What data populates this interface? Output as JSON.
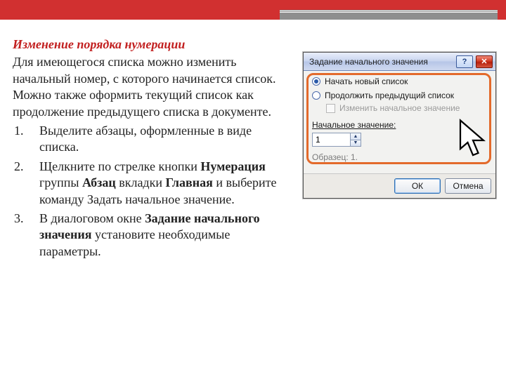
{
  "slide": {
    "title": "Изменение порядка нумерации",
    "paragraph": "Для имеющегося списка можно изменить начальный номер, с которого начинается список. Можно также оформить текущий список как продолжение предыдущего списка в документе.",
    "steps": [
      {
        "text": "Выделите абзацы, оформленные в виде списка."
      },
      {
        "prefix": "Щелкните по стрелке кнопки ",
        "b1": "Нумерация",
        "mid1": " группы ",
        "b2": "Абзац",
        "mid2": " вкладки ",
        "b3": "Главная",
        "suffix": " и выберите команду Задать начальное значение."
      },
      {
        "prefix": "В диалоговом окне ",
        "b1": "Задание начального значения",
        "suffix": "  установите необходимые параметры."
      }
    ]
  },
  "dialog": {
    "title": "Задание начального значения",
    "help": "?",
    "close": "✕",
    "radio_new": "Начать новый список",
    "radio_continue": "Продолжить предыдущий список",
    "check_label": "Изменить начальное значение",
    "start_label": "Начальное значение:",
    "start_value": "1",
    "sample_label": "Образец: 1.",
    "ok": "ОК",
    "cancel": "Отмена"
  }
}
